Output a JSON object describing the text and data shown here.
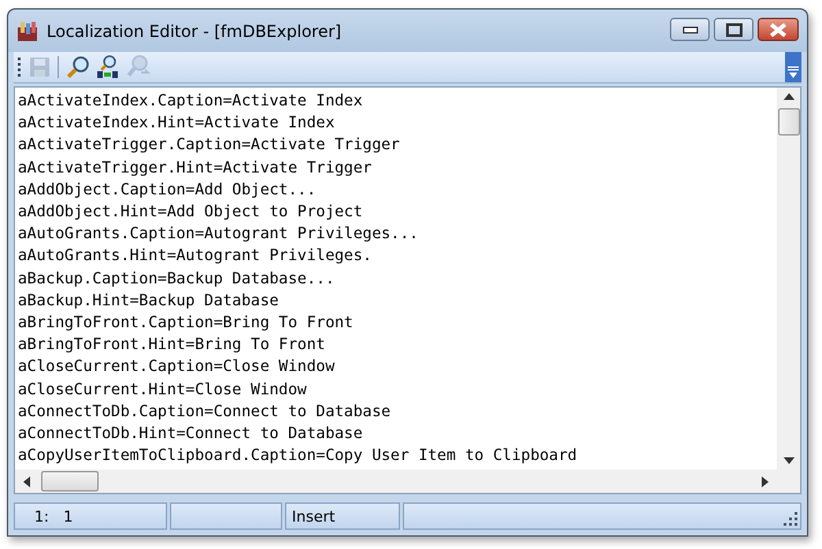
{
  "window": {
    "title": "Localization Editor - [fmDBExplorer]"
  },
  "toolbar": {
    "buttons": [
      {
        "kind": "save",
        "disabled": true
      },
      {
        "kind": "find",
        "disabled": false
      },
      {
        "kind": "replace",
        "disabled": false
      },
      {
        "kind": "findnext",
        "disabled": true
      }
    ]
  },
  "editor": {
    "lines": [
      "aActivateIndex.Caption=Activate Index",
      "aActivateIndex.Hint=Activate Index",
      "aActivateTrigger.Caption=Activate Trigger",
      "aActivateTrigger.Hint=Activate Trigger",
      "aAddObject.Caption=Add Object...",
      "aAddObject.Hint=Add Object to Project",
      "aAutoGrants.Caption=Autogrant Privileges...",
      "aAutoGrants.Hint=Autogrant Privileges.",
      "aBackup.Caption=Backup Database...",
      "aBackup.Hint=Backup Database",
      "aBringToFront.Caption=Bring To Front",
      "aBringToFront.Hint=Bring To Front",
      "aCloseCurrent.Caption=Close Window",
      "aCloseCurrent.Hint=Close Window",
      "aConnectToDb.Caption=Connect to Database",
      "aConnectToDb.Hint=Connect to Database",
      "aCopyUserItemToClipboard.Caption=Copy User Item to Clipboard"
    ]
  },
  "status_bar": {
    "position": "1:   1",
    "mode": "Insert"
  }
}
